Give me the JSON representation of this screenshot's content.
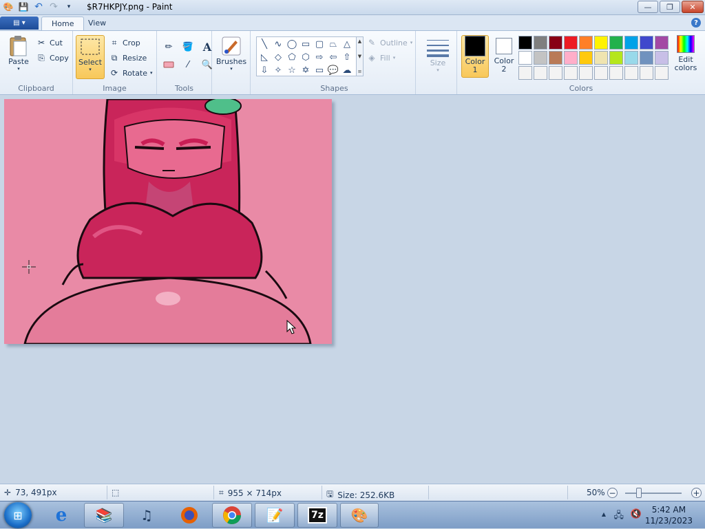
{
  "window": {
    "title": "$R7HKPJY.png - Paint"
  },
  "tabs": [
    {
      "label": "Home"
    },
    {
      "label": "View"
    }
  ],
  "ribbon": {
    "clipboard": {
      "label": "Clipboard",
      "paste": "Paste",
      "cut": "Cut",
      "copy": "Copy"
    },
    "image": {
      "label": "Image",
      "select": "Select",
      "crop": "Crop",
      "resize": "Resize",
      "rotate": "Rotate"
    },
    "tools": {
      "label": "Tools"
    },
    "brushes": {
      "label": "Brushes"
    },
    "shapes": {
      "label": "Shapes",
      "outline": "Outline",
      "fill": "Fill"
    },
    "size": {
      "label": "Size"
    },
    "colors": {
      "label": "Colors",
      "color1_line1": "Color",
      "color1_line2": "1",
      "color2_line1": "Color",
      "color2_line2": "2",
      "edit_line1": "Edit",
      "edit_line2": "colors",
      "color1": "#000000",
      "color2": "#ffffff",
      "palette": [
        "#000000",
        "#7f7f7f",
        "#880015",
        "#ed1c24",
        "#ff7f27",
        "#fff200",
        "#22b14c",
        "#00a2e8",
        "#3f48cc",
        "#a349a4",
        "#ffffff",
        "#c3c3c3",
        "#b97a57",
        "#ffaec9",
        "#ffc90e",
        "#efe4b0",
        "#b5e61d",
        "#99d9ea",
        "#7092be",
        "#c8bfe7",
        "#f3f3f3",
        "#f3f3f3",
        "#f3f3f3",
        "#f3f3f3",
        "#f3f3f3",
        "#f3f3f3",
        "#f3f3f3",
        "#f3f3f3",
        "#f3f3f3",
        "#f3f3f3"
      ]
    }
  },
  "status": {
    "cursor_pos": "73, 491px",
    "image_size": "955 × 714px",
    "file_size": "Size: 252.6KB",
    "zoom": "50%"
  },
  "clock": {
    "time": "5:42 AM",
    "date": "11/23/2023"
  }
}
